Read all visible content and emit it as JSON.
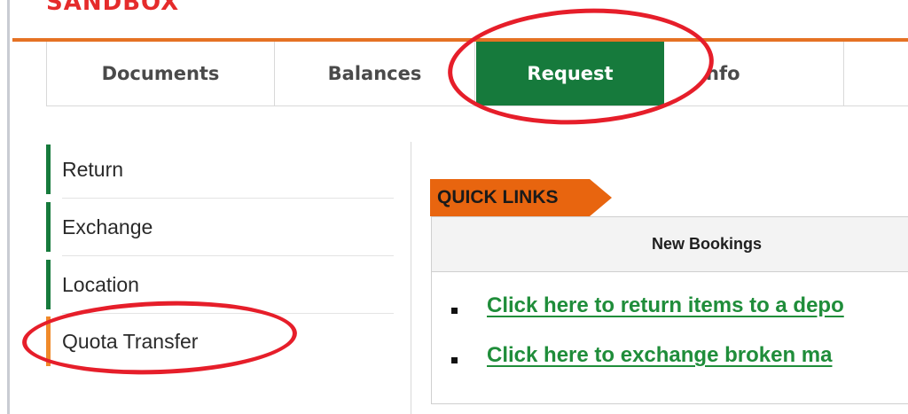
{
  "brand": {
    "name": "SANDBOX",
    "color": "#e52b2b"
  },
  "tabs": [
    {
      "label": "Documents",
      "active": false
    },
    {
      "label": "Balances",
      "active": false
    },
    {
      "label": "Request",
      "active": true
    },
    {
      "label": "Info",
      "visible_text": "nfo",
      "active": false
    }
  ],
  "sidebar": {
    "items": [
      {
        "label": "Return"
      },
      {
        "label": "Exchange"
      },
      {
        "label": "Location"
      },
      {
        "label": "Quota Transfer"
      }
    ]
  },
  "quick_links": {
    "title": "QUICK LINKS",
    "panel_header": "New Bookings",
    "links": [
      {
        "label": "Click here to return items to a depo"
      },
      {
        "label": "Click here to exchange broken ma"
      }
    ]
  },
  "colors": {
    "header_line": "#e57224",
    "active_tab": "#167a3c",
    "sidebar_bar": "#167a3c",
    "sidebar_bar_quota": "#f08a2a",
    "quick_links_tag": "#e8650f",
    "link": "#1f8d3a",
    "annotation": "#e61e2a"
  }
}
